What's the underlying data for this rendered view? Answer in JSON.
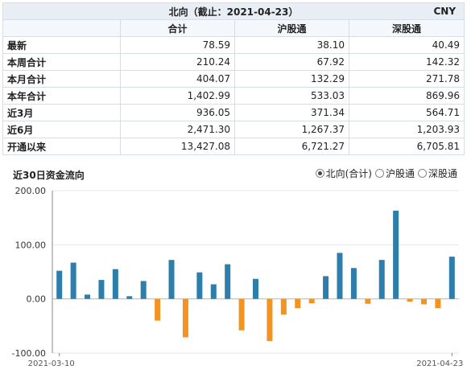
{
  "table": {
    "title": "北向（截止：2021-04-23）",
    "currency": "CNY",
    "headers": [
      "",
      "合计",
      "沪股通",
      "深股通"
    ],
    "rows": [
      {
        "label": "最新",
        "values": [
          "78.59",
          "38.10",
          "40.49"
        ]
      },
      {
        "label": "本周合计",
        "values": [
          "210.24",
          "67.92",
          "142.32"
        ]
      },
      {
        "label": "本月合计",
        "values": [
          "404.07",
          "132.29",
          "271.78"
        ]
      },
      {
        "label": "本年合计",
        "values": [
          "1,402.99",
          "533.03",
          "869.96"
        ]
      },
      {
        "label": "近3月",
        "values": [
          "936.05",
          "371.34",
          "564.71"
        ]
      },
      {
        "label": "近6月",
        "values": [
          "2,471.30",
          "1,267.37",
          "1,203.93"
        ]
      },
      {
        "label": "开通以来",
        "values": [
          "13,427.08",
          "6,721.27",
          "6,705.81"
        ]
      }
    ]
  },
  "chart_header": {
    "title": "近30日资金流向",
    "options": [
      {
        "label": "北向(合计)",
        "selected": true
      },
      {
        "label": "沪股通",
        "selected": false
      },
      {
        "label": "深股通",
        "selected": false
      }
    ]
  },
  "chart_data": {
    "type": "bar",
    "colors": {
      "positive": "#2d7eaa",
      "negative": "#f39322"
    },
    "ylim": [
      -100,
      200
    ],
    "yticks": [
      "200.00",
      "100.00",
      "0.00",
      "-100.00"
    ],
    "ytick_values": [
      200,
      100,
      0,
      -100
    ],
    "xticks": [
      "2021-03-10",
      "2021-04-23"
    ],
    "values": [
      52,
      67,
      8,
      35,
      55,
      5,
      33,
      -40,
      72,
      -71,
      49,
      27,
      64,
      -58,
      37,
      -78,
      -29,
      -17,
      -8,
      42,
      85,
      57,
      -9,
      72,
      163,
      -5,
      -10,
      -17,
      78
    ]
  }
}
